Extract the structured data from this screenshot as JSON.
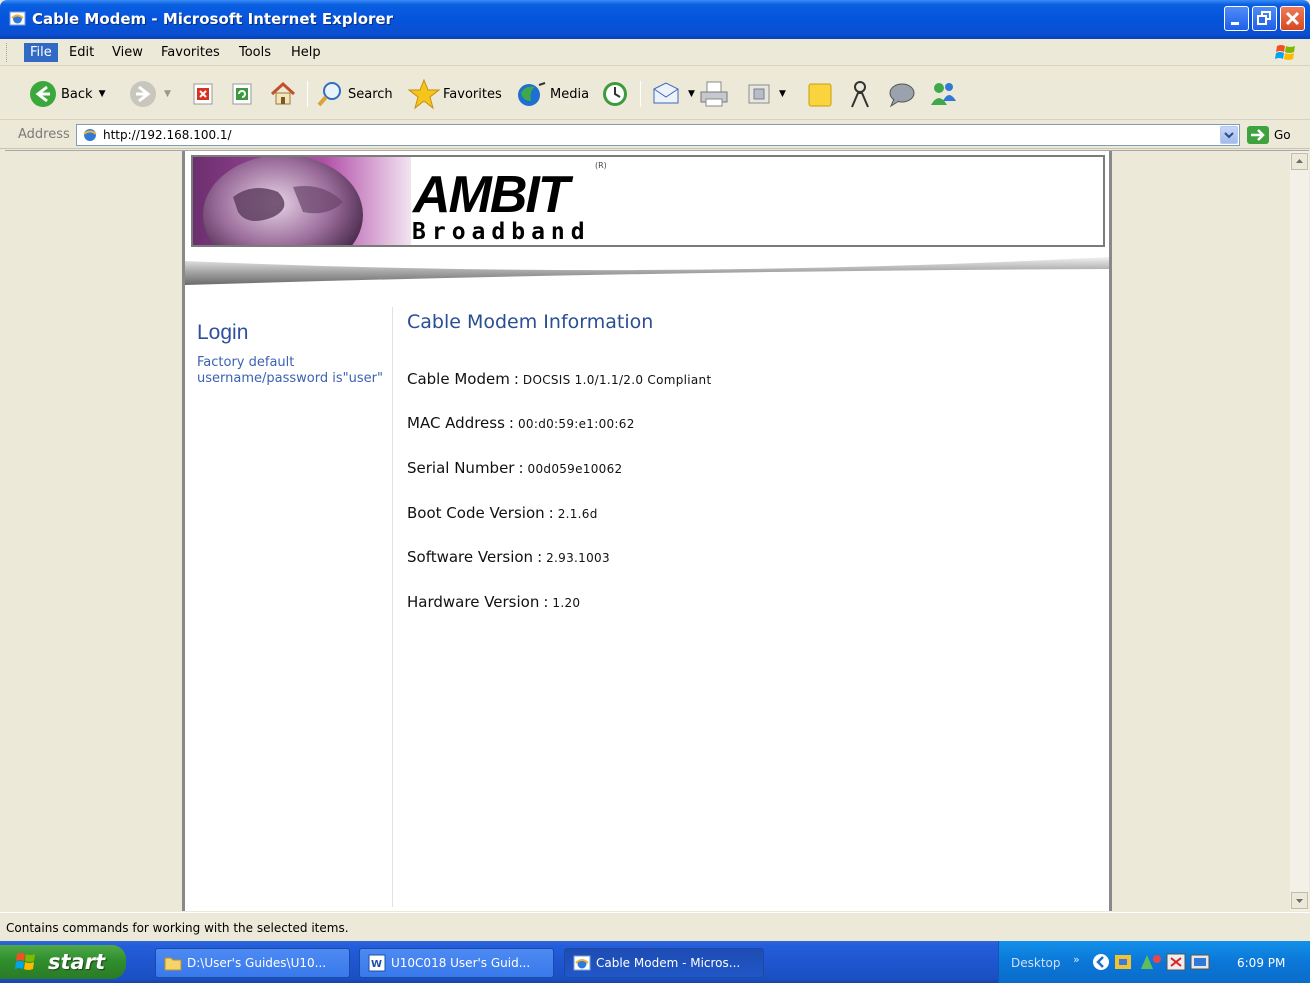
{
  "window": {
    "title": "Cable Modem - Microsoft Internet Explorer"
  },
  "menu": {
    "items": [
      "File",
      "Edit",
      "View",
      "Favorites",
      "Tools",
      "Help"
    ]
  },
  "toolbar": {
    "back_label": "Back",
    "search_label": "Search",
    "favorites_label": "Favorites",
    "media_label": "Media"
  },
  "address": {
    "label": "Address",
    "url": "http://192.168.100.1/",
    "go_label": "Go"
  },
  "page": {
    "logo_main": "AMBIT",
    "logo_tm": "(R)",
    "logo_sub": "Broadband",
    "sidebar": {
      "login_title": "Login",
      "login_note": "Factory default username/password is\"user\""
    },
    "main": {
      "heading": "Cable Modem Information",
      "rows": [
        {
          "key": "Cable Modem",
          "sep": ":",
          "value": "DOCSIS 1.0/1.1/2.0 Compliant"
        },
        {
          "key": "MAC Address",
          "sep": ":",
          "value": "00:d0:59:e1:00:62"
        },
        {
          "key": "Serial Number",
          "sep": ":",
          "value": "00d059e10062"
        },
        {
          "key": "Boot Code Version",
          "sep": ":",
          "value": "2.1.6d"
        },
        {
          "key": "Software Version",
          "sep": ":",
          "value": "2.93.1003"
        },
        {
          "key": "Hardware Version",
          "sep": ":",
          "value": "1.20"
        }
      ]
    }
  },
  "status": {
    "text": "Contains commands for working with the selected items."
  },
  "taskbar": {
    "start_label": "start",
    "tasks": [
      {
        "label": "D:\\User's Guides\\U10..."
      },
      {
        "label": "U10C018 User's Guid..."
      },
      {
        "label": "Cable Modem - Micros..."
      }
    ],
    "desktop_label": "Desktop",
    "clock": "6:09 PM"
  },
  "colors": {
    "titlebar": "#0554dc",
    "taskbar": "#245edb",
    "link_blue": "#3b62b3",
    "heading_blue": "#2a4e93"
  }
}
